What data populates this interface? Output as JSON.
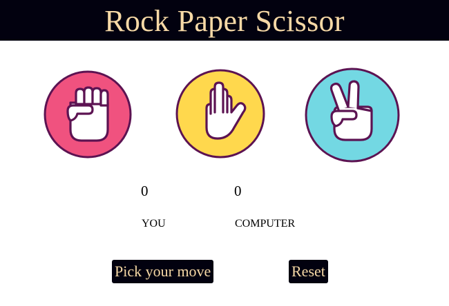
{
  "title": "Rock Paper Scissor",
  "choices": [
    {
      "id": "rock",
      "icon": "fist-icon",
      "color": "#f0527f"
    },
    {
      "id": "paper",
      "icon": "open-hand-icon",
      "color": "#ffd84d"
    },
    {
      "id": "scissor",
      "icon": "peace-hand-icon",
      "color": "#73d8e3"
    }
  ],
  "score": {
    "you": "0",
    "you_label": "YOU",
    "computer": "0",
    "computer_label": "COMPUTER"
  },
  "buttons": {
    "pick": "Pick your move",
    "reset": "Reset"
  },
  "colors": {
    "header_bg": "#02010f",
    "header_text": "#f7d9a6",
    "icon_outline": "#5c1352"
  }
}
